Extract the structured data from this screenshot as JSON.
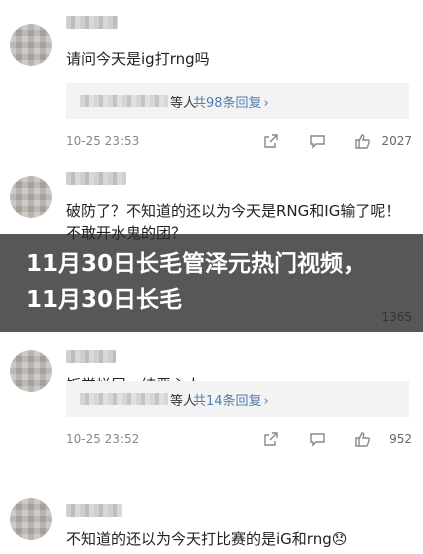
{
  "comments": [
    {
      "text": "请问今天是ig打rng吗",
      "reply_who": "等人",
      "reply_link": "共98条回复",
      "date": "10-25 23:53",
      "likes": "2027"
    },
    {
      "text": "破防了？不知道的还以为今天是RNG和IG输了呢！不敢开水鬼的团？",
      "date": "",
      "likes": "1365"
    },
    {
      "text": "饭堂烂尾，纯恶心人",
      "reply_who": "等人",
      "reply_link": "共14条回复",
      "date": "10-25 23:52",
      "likes": "952"
    },
    {
      "text": "不知道的还以为今天打比赛的是iG和rng😞"
    }
  ],
  "banner": {
    "title": "11月30日长毛管泽元热门视频，11月30日长毛"
  },
  "icons": {
    "share": "share-icon",
    "comment": "comment-icon",
    "like": "thumbs-up-icon"
  }
}
